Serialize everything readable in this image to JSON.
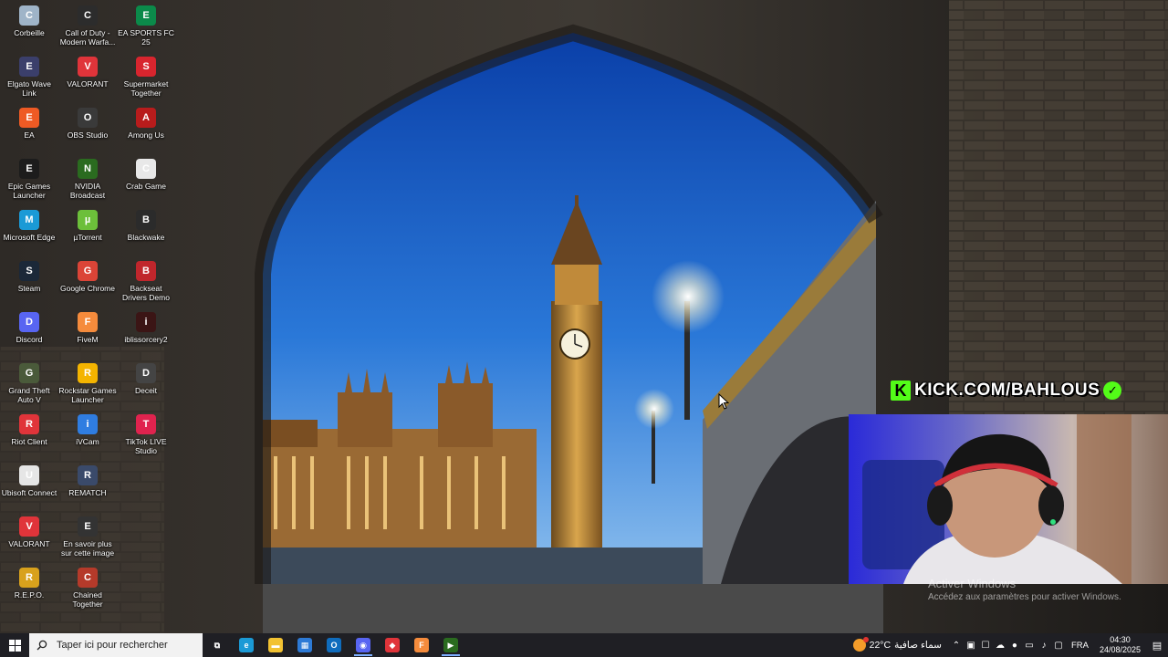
{
  "desktop": {
    "icons": [
      {
        "label": "Corbeille",
        "icon": "recycle-bin-icon",
        "color": "#9fb4c8"
      },
      {
        "label": "Call of Duty - Modern Warfa...",
        "icon": "call-of-duty-icon",
        "color": "#2c2c2c"
      },
      {
        "label": "EA SPORTS FC 25",
        "icon": "ea-sports-fc-icon",
        "color": "#0b8a4a"
      },
      {
        "label": "Elgato Wave Link",
        "icon": "elgato-wave-link-icon",
        "color": "#3b3f6b"
      },
      {
        "label": "VALORANT",
        "icon": "valorant-icon",
        "color": "#e0343a"
      },
      {
        "label": "Supermarket Together",
        "icon": "supermarket-together-icon",
        "color": "#d8252e"
      },
      {
        "label": "EA",
        "icon": "ea-icon",
        "color": "#ee5a24"
      },
      {
        "label": "OBS Studio",
        "icon": "obs-studio-icon",
        "color": "#3a3a3a"
      },
      {
        "label": "Among Us",
        "icon": "among-us-icon",
        "color": "#b81c1c"
      },
      {
        "label": "Epic Games Launcher",
        "icon": "epic-games-icon",
        "color": "#1c1c1c"
      },
      {
        "label": "NVIDIA Broadcast",
        "icon": "nvidia-broadcast-icon",
        "color": "#2a6b1f"
      },
      {
        "label": "Crab Game",
        "icon": "crab-game-icon",
        "color": "#e8e8e8"
      },
      {
        "label": "Microsoft Edge",
        "icon": "microsoft-edge-icon",
        "color": "#1b9ad6"
      },
      {
        "label": "µTorrent",
        "icon": "utorrent-icon",
        "color": "#6cbf3a"
      },
      {
        "label": "Blackwake",
        "icon": "blackwake-icon",
        "color": "#2b2b2b"
      },
      {
        "label": "Steam",
        "icon": "steam-icon",
        "color": "#1b2838"
      },
      {
        "label": "Google Chrome",
        "icon": "google-chrome-icon",
        "color": "#db4437"
      },
      {
        "label": "Backseat Drivers Demo",
        "icon": "backseat-drivers-icon",
        "color": "#c0262c"
      },
      {
        "label": "Discord",
        "icon": "discord-icon",
        "color": "#5865f2"
      },
      {
        "label": "FiveM",
        "icon": "fivem-icon",
        "color": "#f58b3c"
      },
      {
        "label": "iblissorcery2",
        "icon": "iblissorcery-icon",
        "color": "#3b1515"
      },
      {
        "label": "Grand Theft Auto V",
        "icon": "gta-v-icon",
        "color": "#4a5a3a"
      },
      {
        "label": "Rockstar Games Launcher",
        "icon": "rockstar-icon",
        "color": "#f4b400"
      },
      {
        "label": "Deceit",
        "icon": "deceit-icon",
        "color": "#444444"
      },
      {
        "label": "Riot Client",
        "icon": "riot-client-icon",
        "color": "#e0343a"
      },
      {
        "label": "iVCam",
        "icon": "ivcam-icon",
        "color": "#2f7de1"
      },
      {
        "label": "TikTok LIVE Studio",
        "icon": "tiktok-live-icon",
        "color": "#e0234e"
      },
      {
        "label": "Ubisoft Connect",
        "icon": "ubisoft-connect-icon",
        "color": "#e6e6e6"
      },
      {
        "label": "REMATCH",
        "icon": "rematch-icon",
        "color": "#3a4a6a"
      },
      {
        "label": "",
        "icon": "",
        "color": ""
      },
      {
        "label": "VALORANT",
        "icon": "valorant-icon",
        "color": "#e0343a"
      },
      {
        "label": "En savoir plus sur cette image",
        "icon": "camera-info-icon",
        "color": "#333333"
      },
      {
        "label": "",
        "icon": "",
        "color": ""
      },
      {
        "label": "R.E.P.O.",
        "icon": "repo-icon",
        "color": "#d8a11c"
      },
      {
        "label": "Chained Together",
        "icon": "chained-together-icon",
        "color": "#b53a2a"
      }
    ]
  },
  "stream": {
    "kick_text": "KICK.COM/BAHLOUS",
    "kick_logo": "K",
    "kick_color": "#53fc18"
  },
  "watermark": {
    "line1": "Activer Windows",
    "line2": "Accédez aux paramètres pour activer Windows."
  },
  "taskbar": {
    "search_placeholder": "Taper ici pour rechercher",
    "apps": [
      {
        "name": "task-view",
        "icon": "task-view-icon",
        "glyph": "⧉",
        "color": "transparent",
        "active": false
      },
      {
        "name": "edge",
        "icon": "microsoft-edge-icon",
        "glyph": "e",
        "color": "#1b9ad6",
        "active": false
      },
      {
        "name": "file-explorer",
        "icon": "folder-icon",
        "glyph": "▬",
        "color": "#f2c232",
        "active": false
      },
      {
        "name": "microsoft-store",
        "icon": "store-icon",
        "glyph": "▦",
        "color": "#2d7ad6",
        "active": false
      },
      {
        "name": "outlook",
        "icon": "outlook-icon",
        "glyph": "O",
        "color": "#0f6cbd",
        "active": false
      },
      {
        "name": "discord",
        "icon": "discord-icon",
        "glyph": "◉",
        "color": "#5865f2",
        "active": true
      },
      {
        "name": "riot-client",
        "icon": "riot-client-icon",
        "glyph": "◆",
        "color": "#e0343a",
        "active": false
      },
      {
        "name": "fivem",
        "icon": "fivem-icon",
        "glyph": "F",
        "color": "#f58b3c",
        "active": false
      },
      {
        "name": "nvidia-broadcast",
        "icon": "nvidia-broadcast-icon",
        "glyph": "▶",
        "color": "#2a6b1f",
        "active": true
      }
    ],
    "weather": {
      "temp": "22°C",
      "condition": "سماء صافية"
    },
    "language": "FRA",
    "time": "04:30",
    "date": "24/08/2025"
  }
}
